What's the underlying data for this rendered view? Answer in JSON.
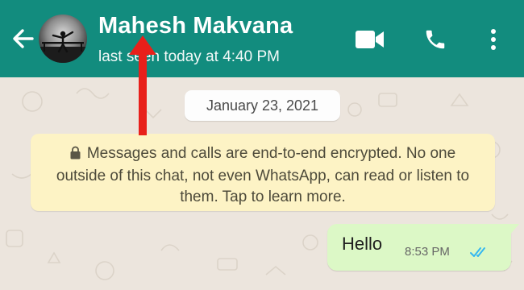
{
  "header": {
    "contact_name": "Mahesh Makvana",
    "status": "last seen today at 4:40 PM",
    "icons": [
      "back-arrow-icon",
      "video-call-icon",
      "voice-call-icon",
      "more-options-icon"
    ]
  },
  "chat": {
    "date_chip": "January 23, 2021",
    "encryption_notice": "Messages and calls are end-to-end encrypted. No one outside of this chat, not even WhatsApp, can read or listen to them. Tap to learn more.",
    "messages": [
      {
        "direction": "outgoing",
        "text": "Hello",
        "time": "8:53 PM",
        "status": "read"
      }
    ]
  },
  "colors": {
    "header": "#128c7e",
    "chat_background": "#ece5dd",
    "outgoing_bubble": "#dcf8c6",
    "notice_background": "#fdf3c5",
    "read_ticks": "#34b7f1",
    "annotation_arrow": "#e8201a"
  }
}
